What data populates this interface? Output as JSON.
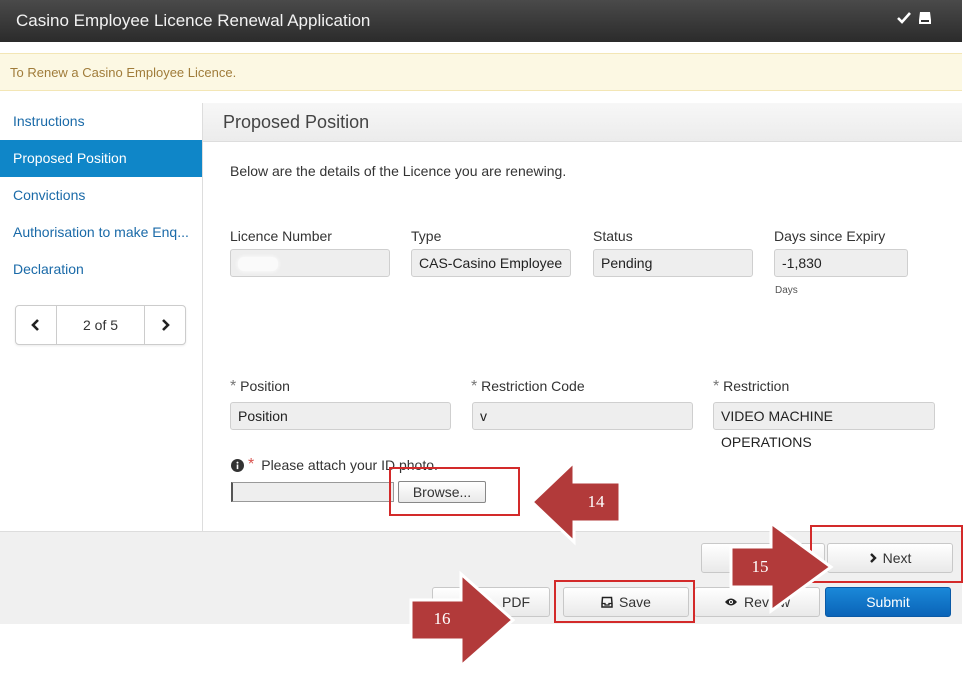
{
  "window": {
    "title": "Casino Employee Licence Renewal Application"
  },
  "alert": {
    "text": "To Renew a Casino Employee Licence."
  },
  "sidebar": {
    "items": [
      {
        "label": "Instructions"
      },
      {
        "label": "Proposed Position"
      },
      {
        "label": "Convictions"
      },
      {
        "label": "Authorisation to make Enq..."
      },
      {
        "label": "Declaration"
      }
    ],
    "active_index": 1,
    "pager": {
      "text": "2 of 5"
    }
  },
  "panel": {
    "title": "Proposed Position",
    "intro": "Below are the details of the Licence you are renewing.",
    "licence": {
      "number_label": "Licence Number",
      "number_value": "",
      "type_label": "Type",
      "type_value": "CAS-Casino Employee",
      "status_label": "Status",
      "status_value": "Pending",
      "expiry_label": "Days since Expiry",
      "expiry_value": "-1,830",
      "expiry_unit": "Days"
    },
    "position": {
      "position_label": "Position",
      "position_value": "Position",
      "code_label": "Restriction Code",
      "code_value": "v",
      "restriction_label": "Restriction",
      "restriction_value": "VIDEO MACHINE OPERATIONS"
    },
    "attach": {
      "label": "Please attach your ID photo.",
      "browse_label": "Browse..."
    }
  },
  "footer": {
    "next_label": "Next",
    "pdf_label": "PDF",
    "save_label": "Save",
    "review_label": "Review",
    "submit_label": "Submit"
  },
  "callouts": {
    "first": "14",
    "second": "15",
    "third": "16"
  },
  "colors": {
    "accent": "#0f86c8",
    "submit": "#0a64b8",
    "callout": "#b23a3a",
    "highlight": "#d32a2a",
    "alert_bg": "#fcf8e3"
  }
}
